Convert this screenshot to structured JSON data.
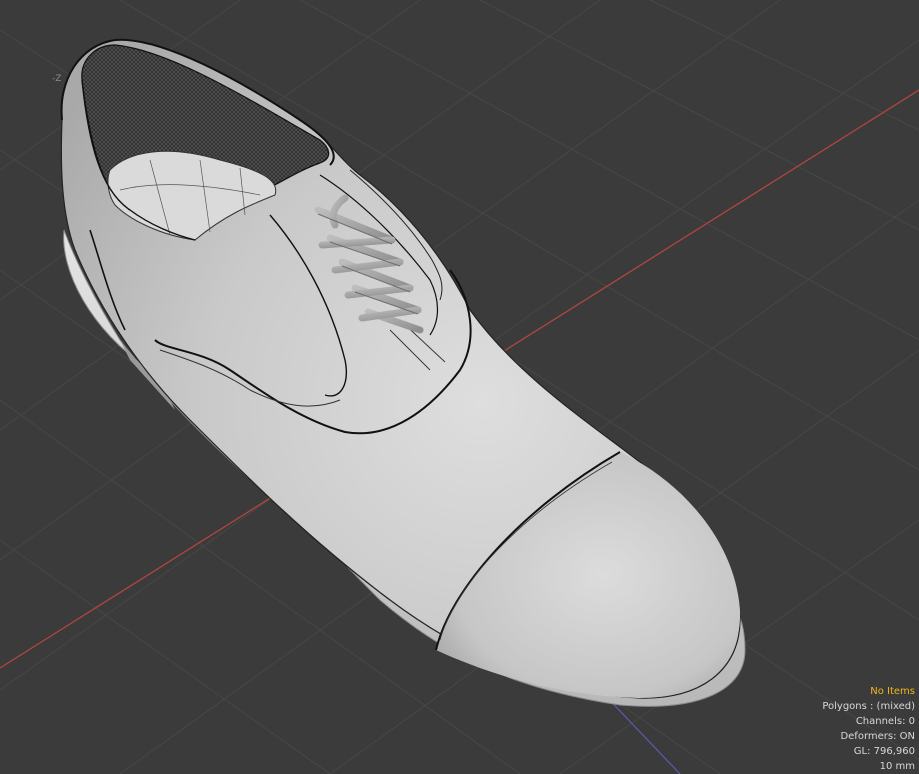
{
  "viewport": {
    "axis_label": "-Z",
    "hud": {
      "selection": "No Items",
      "polygons": "Polygons : (mixed)",
      "channels": "Channels: 0",
      "deformers": "Deformers: ON",
      "gl": "GL: 796,960",
      "grid_size": "10 mm"
    },
    "colors": {
      "background": "#3b3b3b",
      "grid": "#4a4a4a",
      "x_axis": "#b5473c",
      "z_axis": "#5a5ab0",
      "hud_warning": "#f2b51e",
      "hud_text": "#d8d8d8",
      "model": "#cdcdcd"
    },
    "object": "shoe-model"
  }
}
